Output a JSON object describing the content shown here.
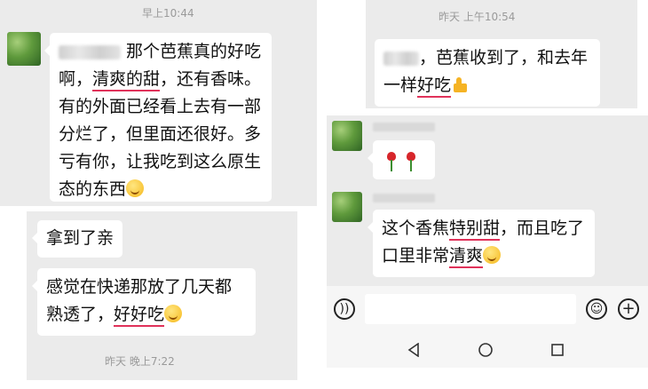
{
  "panel1": {
    "time": "早上10:44",
    "msg_part1": "那个芭蕉真的好吃啊，",
    "msg_u1": "清爽的甜",
    "msg_part2": "，还有香味。有的外面已经看上去有一部分烂了，但里面还很好。多亏有你，让我吃到这么原生态的东西",
    "emoji": "blush-emoji"
  },
  "panel2": {
    "msg1": "拿到了亲",
    "msg2_part1": "感觉在快递那放了几天都熟透了，",
    "msg2_u": "好好吃",
    "emoji": "thinking-emoji",
    "time": "昨天 晚上7:22"
  },
  "panel3": {
    "time": "昨天 上午10:54",
    "msg_part1": "，芭蕉收到了，和去年一样",
    "msg_u": "好吃",
    "emoji": "thumbs-up-emoji"
  },
  "panel4": {
    "roses": [
      "rose",
      "rose"
    ],
    "msg_part1": "这个香焦",
    "msg_u1": "特别甜",
    "msg_part2": "，而且吃了口里非常",
    "msg_u2": "清爽",
    "emoji": "grin-emoji"
  },
  "inputbar": {
    "voice_icon": "voice-icon",
    "emoji_icon": "smiley-icon",
    "plus_icon": "plus-icon",
    "input_value": ""
  },
  "navbar": {
    "back": "back-icon",
    "home": "home-icon",
    "recent": "recent-apps-icon"
  },
  "colors": {
    "underline": "#e0325a",
    "chat_bg": "#ebebeb",
    "bubble": "#ffffff"
  }
}
